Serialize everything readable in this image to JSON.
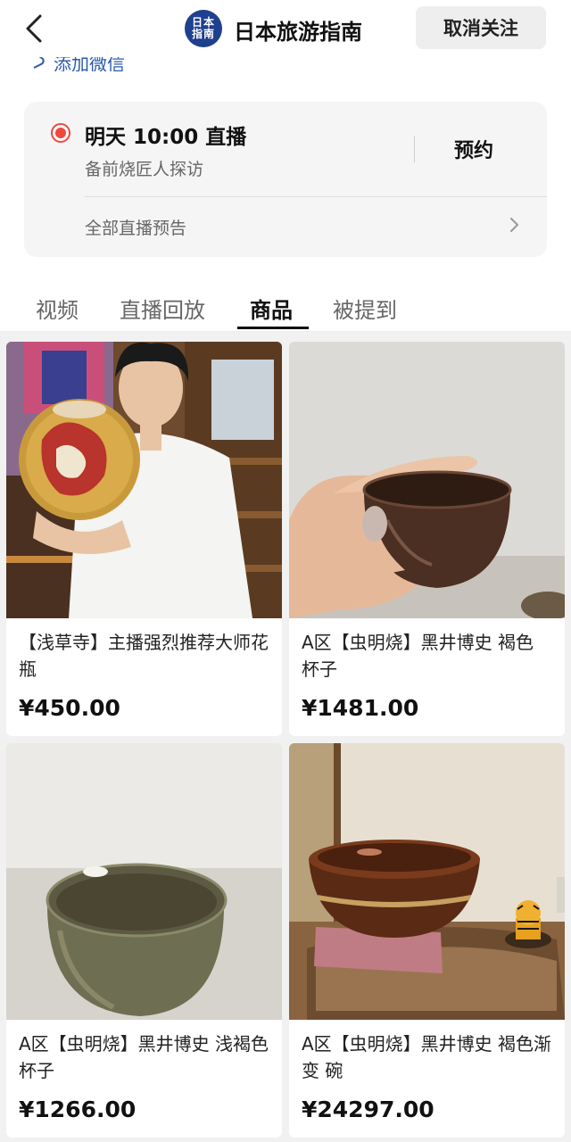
{
  "header": {
    "channel_logo_text_top": "日本",
    "channel_logo_text_bottom": "指南",
    "channel_name": "日本旅游指南",
    "unfollow_label": "取消关注"
  },
  "wechat_row": {
    "label": "添加微信"
  },
  "live": {
    "time": "明天 10:00 直播",
    "subtitle": "备前烧匠人探访",
    "reserve_label": "预约",
    "all_preview_label": "全部直播预告",
    "accent": "#f0483e"
  },
  "tabs": [
    {
      "label": "视频",
      "active": false
    },
    {
      "label": "直播回放",
      "active": false
    },
    {
      "label": "商品",
      "active": true
    },
    {
      "label": "被提到",
      "active": false
    }
  ],
  "products": [
    {
      "title": "【浅草寺】主播强烈推荐大师花瓶",
      "price": "¥450.00",
      "image": "vase-host-photo"
    },
    {
      "title": "A区【虫明烧】黑井博史 褐色 杯子",
      "price": "¥1481.00",
      "image": "brown-cup-in-hand"
    },
    {
      "title": "A区【虫明烧】黑井博史 浅褐色 杯子",
      "price": "¥1266.00",
      "image": "light-brown-cup"
    },
    {
      "title": "A区【虫明烧】黑井博史 褐色渐变 碗",
      "price": "¥24297.00",
      "image": "gradient-bowl-with-tiger"
    }
  ]
}
